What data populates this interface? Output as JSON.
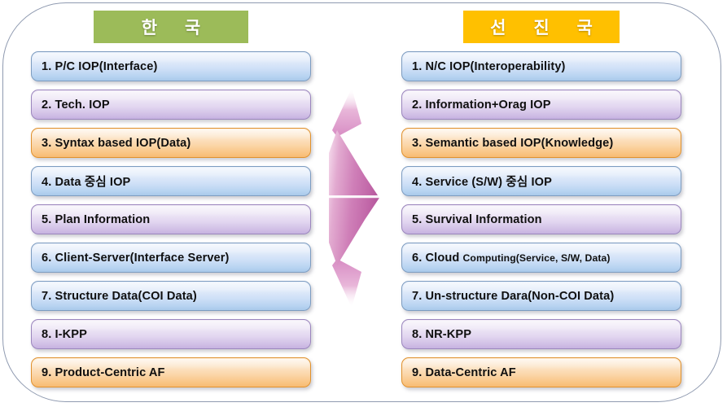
{
  "diagram": {
    "left_column": {
      "title": "한  국",
      "title_color": "#9cbb59",
      "items": [
        {
          "text": "1. P/C IOP(Interface)",
          "color": "blue"
        },
        {
          "text": "2. Tech. IOP",
          "color": "purple"
        },
        {
          "text": "3. Syntax based  IOP(Data)",
          "color": "orange"
        },
        {
          "text": "4. Data 중심 IOP",
          "color": "blue"
        },
        {
          "text": "5. Plan Information",
          "color": "purple"
        },
        {
          "text": "6. Client-Server(Interface Server)",
          "color": "blue"
        },
        {
          "text": "7. Structure Data(COI Data)",
          "color": "blue"
        },
        {
          "text": "8. I-KPP",
          "color": "purple"
        },
        {
          "text": "9. Product-Centric AF",
          "color": "orange"
        }
      ]
    },
    "right_column": {
      "title": "선 진 국",
      "title_color": "#ffc000",
      "items": [
        {
          "text": "1. N/C IOP(Interoperability)",
          "color": "blue"
        },
        {
          "text": "2. Information+Orag IOP",
          "color": "purple"
        },
        {
          "text": "3. Semantic based IOP(Knowledge)",
          "color": "orange"
        },
        {
          "text": "4. Service (S/W) 중심 IOP",
          "color": "blue"
        },
        {
          "text": "5. Survival  Information",
          "color": "purple"
        },
        {
          "text": "6. Cloud ",
          "text_small": "Computing(Service,  S/W,  Data)",
          "color": "blue"
        },
        {
          "text": "7. Un-structure Dara(Non-COI Data)",
          "color": "blue"
        },
        {
          "text": "8. NR-KPP",
          "color": "purple"
        },
        {
          "text": "9. Data-Centric AF",
          "color": "orange"
        }
      ]
    },
    "center_arrow": {
      "name": "right-pointing-arrow",
      "color": "#c96fae"
    },
    "frame_border_color": "#8f9ab0"
  }
}
